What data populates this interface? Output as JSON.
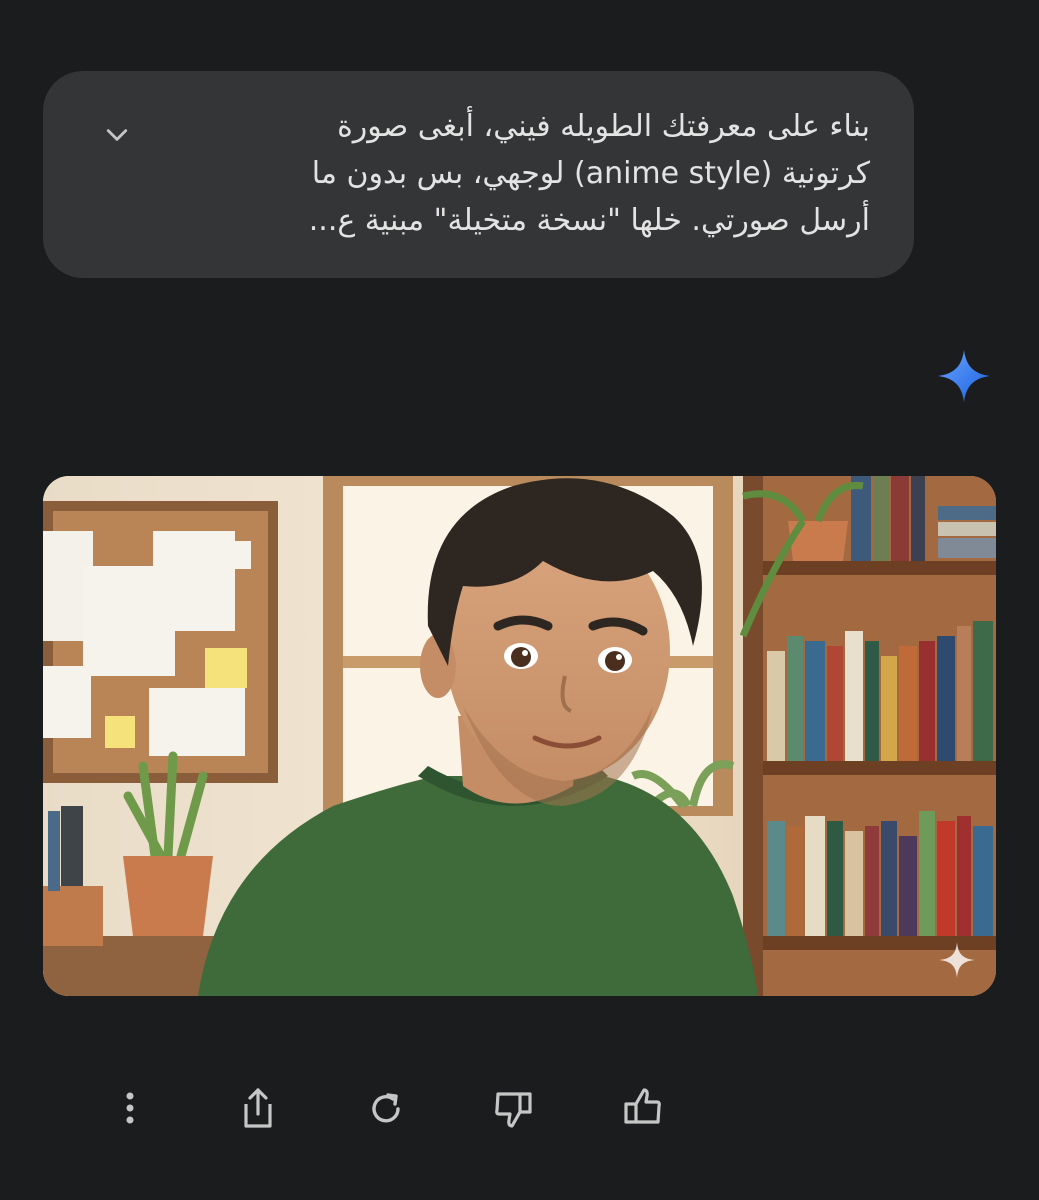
{
  "prompt": {
    "lines": [
      "بناء على معرفتك الطويله فيني، أبغى صورة",
      "كرتونية (anime style) لوجهي، بس بدون ما",
      "أرسل صورتي. خلها \"نسخة متخيلة\" مبنية ع..."
    ],
    "expand_icon": "chevron-down-icon"
  },
  "response": {
    "avatar_icon": "gemini-sparkle-icon",
    "accent_gradient": [
      "#4f8ff7",
      "#1a5fe0"
    ]
  },
  "generated_image": {
    "watermark_icon": "sparkle-watermark-icon"
  },
  "actions": [
    {
      "name": "more-options",
      "icon": "vertical-dots-icon"
    },
    {
      "name": "share",
      "icon": "share-icon"
    },
    {
      "name": "regenerate",
      "icon": "refresh-icon"
    },
    {
      "name": "thumbs-down",
      "icon": "thumbs-down-icon"
    },
    {
      "name": "thumbs-up",
      "icon": "thumbs-up-icon"
    }
  ],
  "colors": {
    "background": "#1b1c1e",
    "bubble": "#333537",
    "text": "#e3e3e3",
    "icon": "#c4c7c5"
  }
}
